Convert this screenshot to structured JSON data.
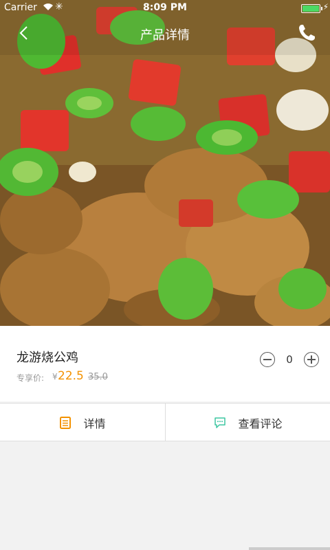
{
  "status_bar": {
    "carrier": "Carrier",
    "time": "8:09 PM"
  },
  "navbar": {
    "title": "产品详情"
  },
  "product": {
    "name": "龙游烧公鸡",
    "price_label": "专享价:",
    "currency": "¥",
    "price": "22.5",
    "original_price": "35.0",
    "quantity": "0"
  },
  "tabs": [
    {
      "label": "详情",
      "icon": "document-icon",
      "icon_color": "#f39200"
    },
    {
      "label": "查看评论",
      "icon": "comment-icon",
      "icon_color": "#3cc5a0"
    }
  ],
  "colors": {
    "accent": "#f39200",
    "battery": "#4cd964"
  }
}
